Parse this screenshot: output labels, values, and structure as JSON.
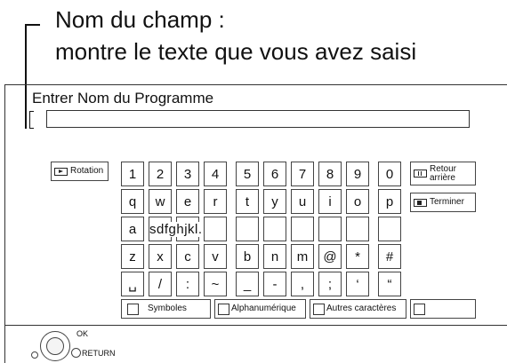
{
  "callout": {
    "line1": "Nom du champ :",
    "line2": "montre le texte que vous avez saisi"
  },
  "field": {
    "label": "Entrer Nom du Programme",
    "value": ""
  },
  "side_left": {
    "rotation": "Rotation"
  },
  "side_right": {
    "retour_line1": "Retour",
    "retour_line2": "arrière",
    "terminer": "Terminer"
  },
  "keys": {
    "row1": [
      "1",
      "2",
      "3",
      "4",
      "5",
      "6",
      "7",
      "8",
      "9",
      "0"
    ],
    "row2": [
      "q",
      "w",
      "e",
      "r",
      "t",
      "y",
      "u",
      "i",
      "o",
      "p"
    ],
    "row3_first": "a",
    "row3_overlay": "sdfghjkl.",
    "row4": [
      "z",
      "x",
      "c",
      "v",
      "b",
      "n",
      "m",
      "@",
      "*",
      "#"
    ],
    "row5": [
      "␣",
      "/",
      ":",
      "~",
      "_",
      "-",
      ",",
      ";",
      "‘",
      "“"
    ]
  },
  "modes": {
    "symboles": "Symboles",
    "alphanumerique": "Alphanumérique",
    "autres": "Autres caractères",
    "extra": ""
  },
  "nav": {
    "ok": "OK",
    "return": "RETURN"
  },
  "colors": {
    "line": "#333333",
    "text": "#111111",
    "background": "#ffffff"
  }
}
